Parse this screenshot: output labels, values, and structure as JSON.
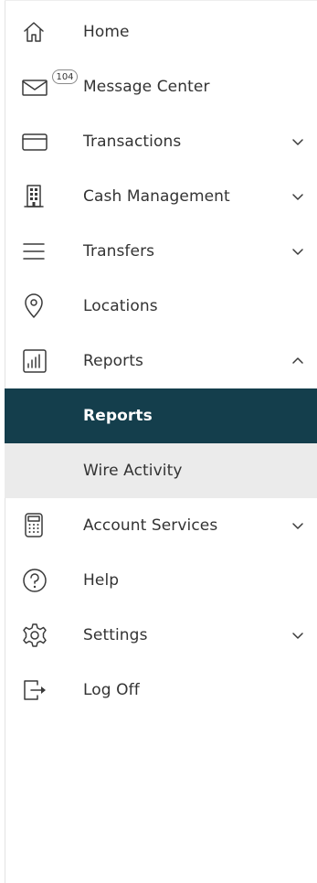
{
  "nav": {
    "items": [
      {
        "label": "Home",
        "icon": "home-icon"
      },
      {
        "label": "Message Center",
        "icon": "envelope-icon",
        "badge": "104"
      },
      {
        "label": "Transactions",
        "icon": "card-icon",
        "expandable": true
      },
      {
        "label": "Cash Management",
        "icon": "building-icon",
        "expandable": true
      },
      {
        "label": "Transfers",
        "icon": "menu-lines-icon",
        "expandable": true
      },
      {
        "label": "Locations",
        "icon": "location-pin-icon"
      },
      {
        "label": "Reports",
        "icon": "bar-chart-icon",
        "expandable": true,
        "expanded": true
      },
      {
        "label": "Account Services",
        "icon": "calculator-icon",
        "expandable": true
      },
      {
        "label": "Help",
        "icon": "question-circle-icon"
      },
      {
        "label": "Settings",
        "icon": "gear-icon",
        "expandable": true
      },
      {
        "label": "Log Off",
        "icon": "logout-icon"
      }
    ],
    "reports_sub": [
      {
        "label": "Reports",
        "active": true
      },
      {
        "label": "Wire Activity",
        "active": false
      }
    ]
  },
  "colors": {
    "active_bg": "#143e4c",
    "sub_bg": "#ebebeb",
    "text": "#333333"
  }
}
